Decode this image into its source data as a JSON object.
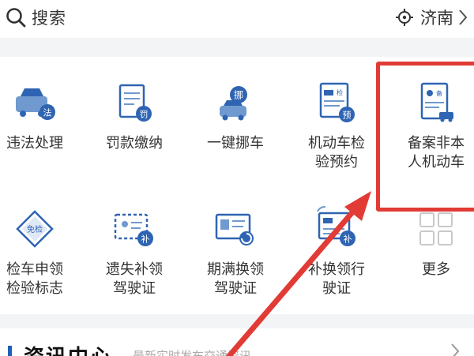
{
  "search": {
    "label": "搜索",
    "icon": "search-icon"
  },
  "location": {
    "city": "济南",
    "icon": "locate-icon"
  },
  "services": [
    {
      "id": "violation",
      "line1": "违法处理",
      "line2": ""
    },
    {
      "id": "fine",
      "line1": "罚款缴纳",
      "line2": ""
    },
    {
      "id": "move-car",
      "line1": "一键挪车",
      "line2": ""
    },
    {
      "id": "inspection",
      "line1": "机动车检",
      "line2": "验预约"
    },
    {
      "id": "register",
      "line1": "备案非本",
      "line2": "人机动车"
    },
    {
      "id": "exempt",
      "line1": "检车申领",
      "line2": "检验标志"
    },
    {
      "id": "lost-license",
      "line1": "遗失补领",
      "line2": "驾驶证"
    },
    {
      "id": "renew-license",
      "line1": "期满换领",
      "line2": "驾驶证"
    },
    {
      "id": "replace-license",
      "line1": "补换领行",
      "line2": "驶证"
    },
    {
      "id": "more",
      "line1": "更多",
      "line2": ""
    }
  ],
  "badges": {
    "fa": "法",
    "fa2": "罚",
    "nuo": "挪",
    "jian": "检",
    "yu": "预",
    "bei": "备",
    "bu": "补",
    "mianjian": "免检"
  },
  "news": {
    "title": "资讯中心",
    "subtitle": "最新实时发布交通资讯"
  },
  "colors": {
    "accent": "#1f5fb8",
    "highlight": "#e23b35"
  }
}
